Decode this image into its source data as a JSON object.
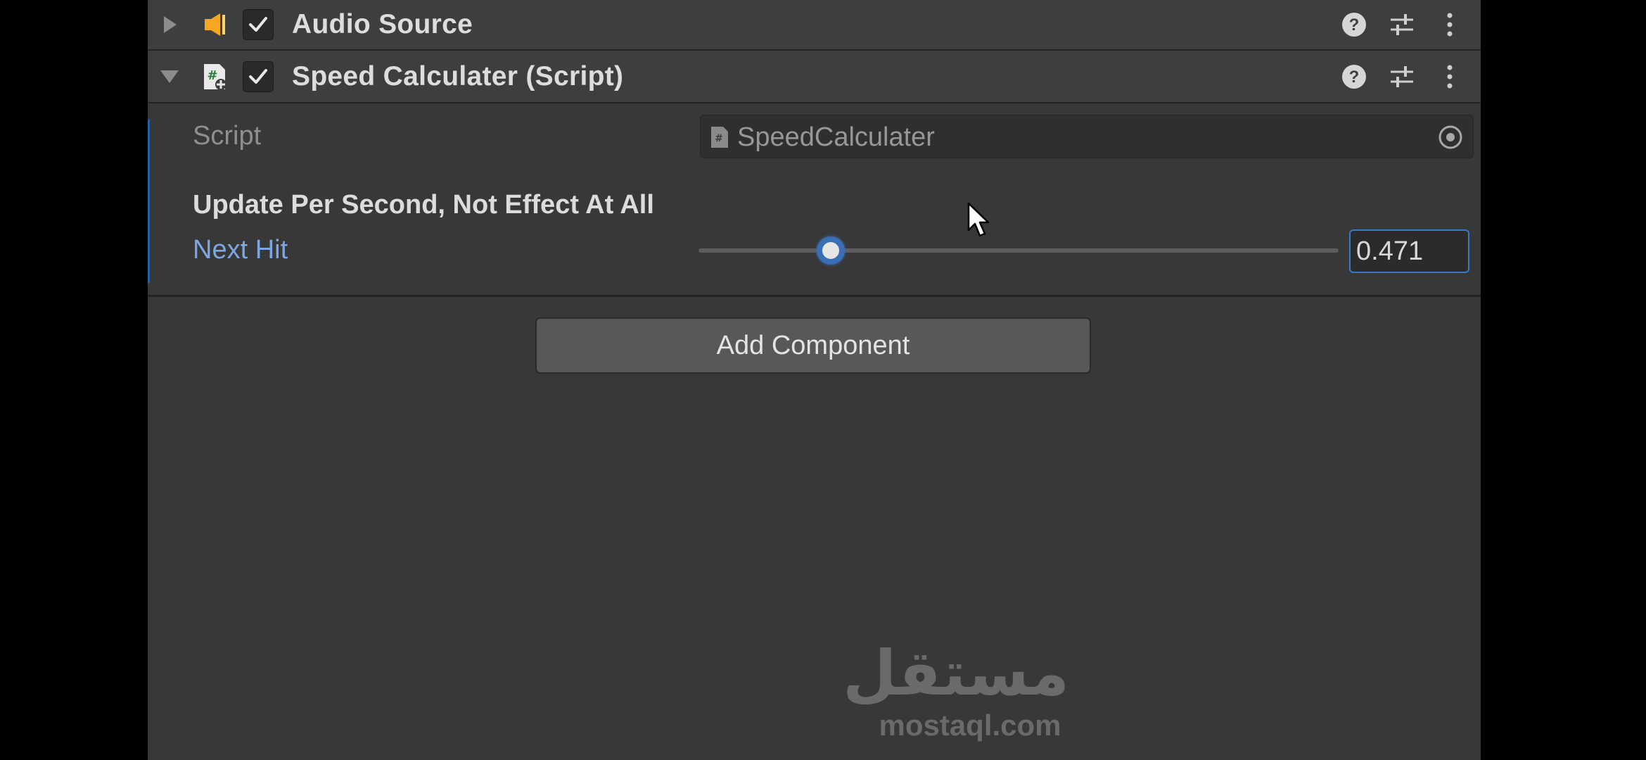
{
  "components": [
    {
      "title": "Audio Source",
      "icon": "audio-source-icon",
      "expanded": false,
      "enabled": true
    },
    {
      "title": "Speed Calculater (Script)",
      "icon": "csharp-script-icon",
      "expanded": true,
      "enabled": true
    }
  ],
  "header_icons": [
    "help-icon",
    "presets-icon",
    "more-options-icon"
  ],
  "script_field": {
    "label": "Script",
    "value": "SpeedCalculater",
    "icon": "script-file-icon"
  },
  "section_header": "Update Per Second, Not Effect At All",
  "next_hit": {
    "label": "Next Hit",
    "value": "0.471",
    "slider_fraction": 0.207
  },
  "add_component_label": "Add Component",
  "watermark": {
    "arabic": "مستقل",
    "url": "mostaql.com"
  },
  "colors": {
    "panel_bg": "#383838",
    "header_bg": "#3e3e3e",
    "accent_blue": "#3a79c9",
    "label_blue": "#7da7e3",
    "audio_icon": "#f5a623"
  }
}
